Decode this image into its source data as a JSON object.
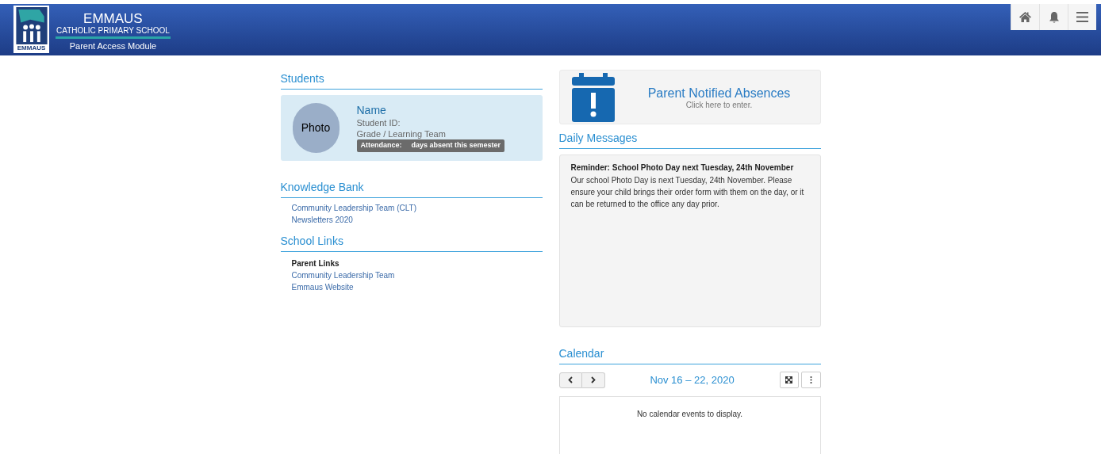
{
  "header": {
    "logo_label": "EMMAUS",
    "school_name": "EMMAUS",
    "school_subtitle": "CATHOLIC PRIMARY SCHOOL",
    "module": "Parent Access Module",
    "actions": [
      {
        "kind": "home"
      },
      {
        "kind": "bell"
      },
      {
        "kind": "menu"
      }
    ]
  },
  "students": {
    "title": "Students",
    "card": {
      "photo": "Photo",
      "name": "Name",
      "student_id": "Student ID:",
      "grade": "Grade / Learning Team",
      "attendance_label": "Attendance:",
      "attendance_text": "days absent this semester"
    }
  },
  "knowledge_bank": {
    "title": "Knowledge Bank",
    "links": [
      "Community Leadership Team (CLT)",
      "Newsletters 2020"
    ]
  },
  "school_links": {
    "title": "School Links",
    "items": [
      {
        "kind": "heading",
        "text": "Parent Links"
      },
      {
        "kind": "link",
        "text": "Community Leadership Team"
      },
      {
        "kind": "link",
        "text": "Emmaus Website"
      }
    ]
  },
  "absences": {
    "title": "Parent Notified Absences",
    "subtitle": "Click here to enter."
  },
  "daily_messages": {
    "title": "Daily Messages",
    "messages": [
      {
        "title": "Reminder: School Photo Day next Tuesday, 24th November",
        "body": "Our school Photo Day is next Tuesday, 24th November. Please ensure your child brings their order form with them on the day, or it can be returned to the office any day prior."
      }
    ]
  },
  "calendar": {
    "title": "Calendar",
    "range": "Nov 16 – 22, 2020",
    "empty": "No calendar events to display."
  }
}
